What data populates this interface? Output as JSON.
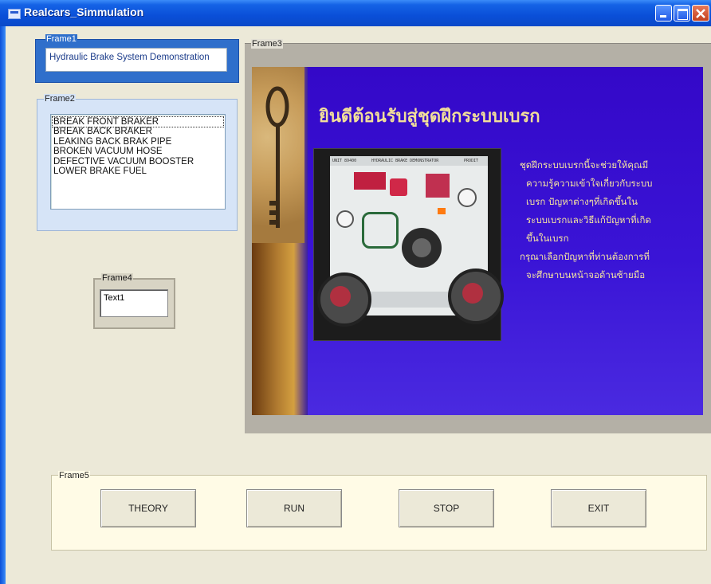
{
  "window": {
    "title": "Realcars_Simmulation"
  },
  "frame1": {
    "caption": "Frame1",
    "heading": "Hydraulic Brake System Demonstration"
  },
  "frame2": {
    "caption": "Frame2",
    "items": [
      "BREAK FRONT BRAKER",
      "BREAK BACK BRAKER",
      "LEAKING BACK BRAK PIPE",
      "BROKEN VACUUM HOSE",
      "DEFECTIVE VACUUM BOOSTER",
      "LOWER BRAKE FUEL"
    ]
  },
  "frame3": {
    "caption": "Frame3",
    "welcome_title": "ยินดีต้อนรับสู่ชุดฝึกระบบเบรก",
    "description_lines": [
      "ชุดฝึกระบบเบรกนี้จะช่วยให้คุณมี",
      "ความรู้ความเข้าใจเกี่ยวกับระบบ",
      "เบรก ปัญหาต่างๆที่เกิดขึ้นใน",
      "ระบบเบรกและวิธีแก้ปัญหาที่เกิด",
      "ขึ้นในเบรก",
      "กรุณาเลือกปัญหาที่ท่านต้องการที่",
      "จะศึกษาบนหน้าจอด้านซ้ายมือ"
    ],
    "board_header_left": "UNIT 89400",
    "board_header_mid": "HYDRAULIC BRAKE DEMONSTRATOR",
    "board_header_right": "PRODIT"
  },
  "frame4": {
    "caption": "Frame4",
    "text_value": "Text1"
  },
  "frame5": {
    "caption": "Frame5",
    "buttons": {
      "theory": "THEORY",
      "run": "RUN",
      "stop": "STOP",
      "exit": "EXIT"
    }
  },
  "colors": {
    "title_bar": "#0a4fd8",
    "frame1_bg": "#2f6fcb",
    "frame2_bg": "#d6e4f7",
    "frame5_bg": "#fffbe6",
    "welcome_bg": "#3a10c8",
    "welcome_text": "#f4e3a0"
  },
  "icons": [
    "app-icon",
    "minimize-icon",
    "maximize-icon",
    "close-icon",
    "key-image",
    "brake-trainer-image"
  ]
}
